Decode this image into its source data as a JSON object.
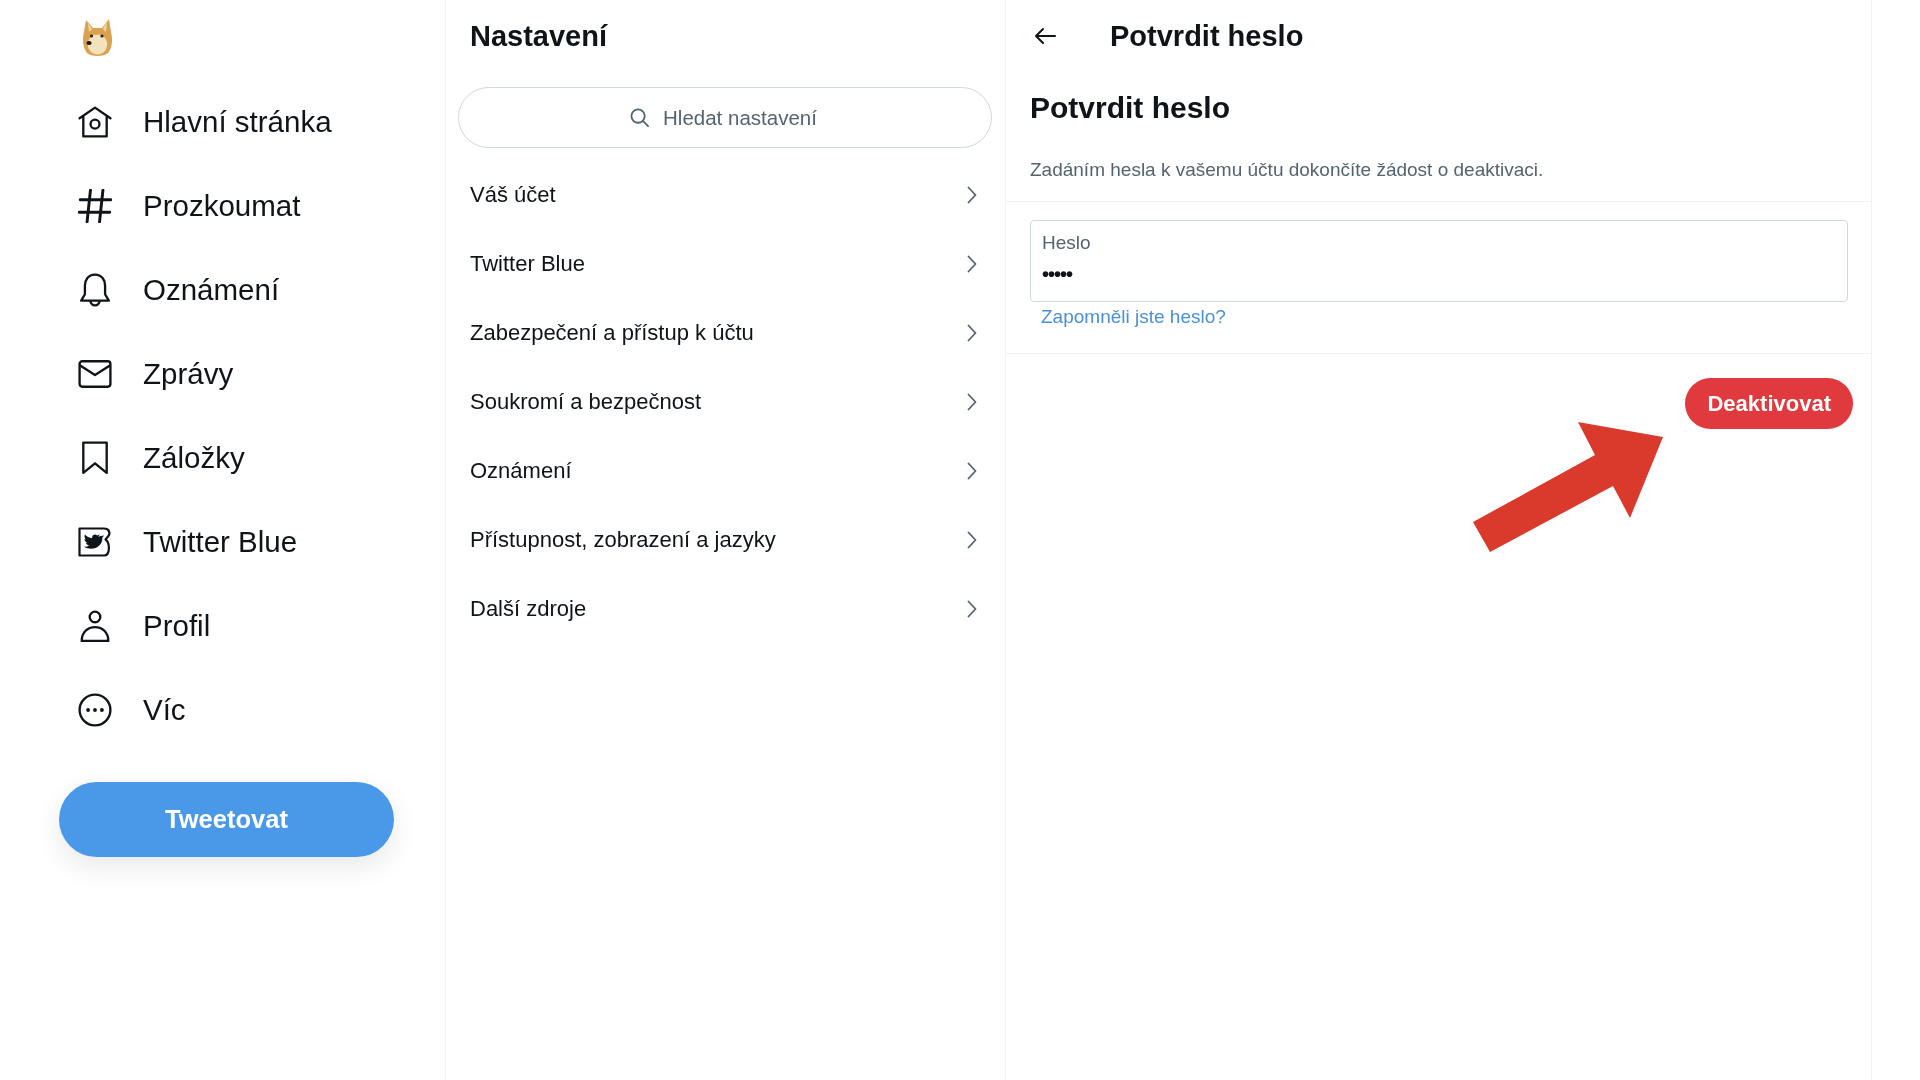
{
  "sidebar": {
    "nav_items": [
      {
        "label": "Hlavní stránka"
      },
      {
        "label": "Prozkoumat"
      },
      {
        "label": "Oznámení"
      },
      {
        "label": "Zprávy"
      },
      {
        "label": "Záložky"
      },
      {
        "label": "Twitter Blue"
      },
      {
        "label": "Profil"
      },
      {
        "label": "Víc"
      }
    ],
    "tweet_button": "Tweetovat"
  },
  "settings": {
    "title": "Nastavení",
    "search": {
      "placeholder": "Hledat nastavení"
    },
    "items": [
      {
        "label": "Váš účet"
      },
      {
        "label": "Twitter Blue"
      },
      {
        "label": "Zabezpečení a přístup k účtu"
      },
      {
        "label": "Soukromí a bezpečnost"
      },
      {
        "label": "Oznámení"
      },
      {
        "label": "Přístupnost, zobrazení a jazyky"
      },
      {
        "label": "Další zdroje"
      }
    ]
  },
  "detail": {
    "header_title": "Potvrdit heslo",
    "heading": "Potvrdit heslo",
    "description": "Zadáním hesla k vašemu účtu dokončíte žádost o deaktivaci.",
    "password_field": {
      "label": "Heslo",
      "value": "•••••"
    },
    "forgot_link": "Zapomněli jste heslo?",
    "deactivate_button": "Deaktivovat"
  }
}
